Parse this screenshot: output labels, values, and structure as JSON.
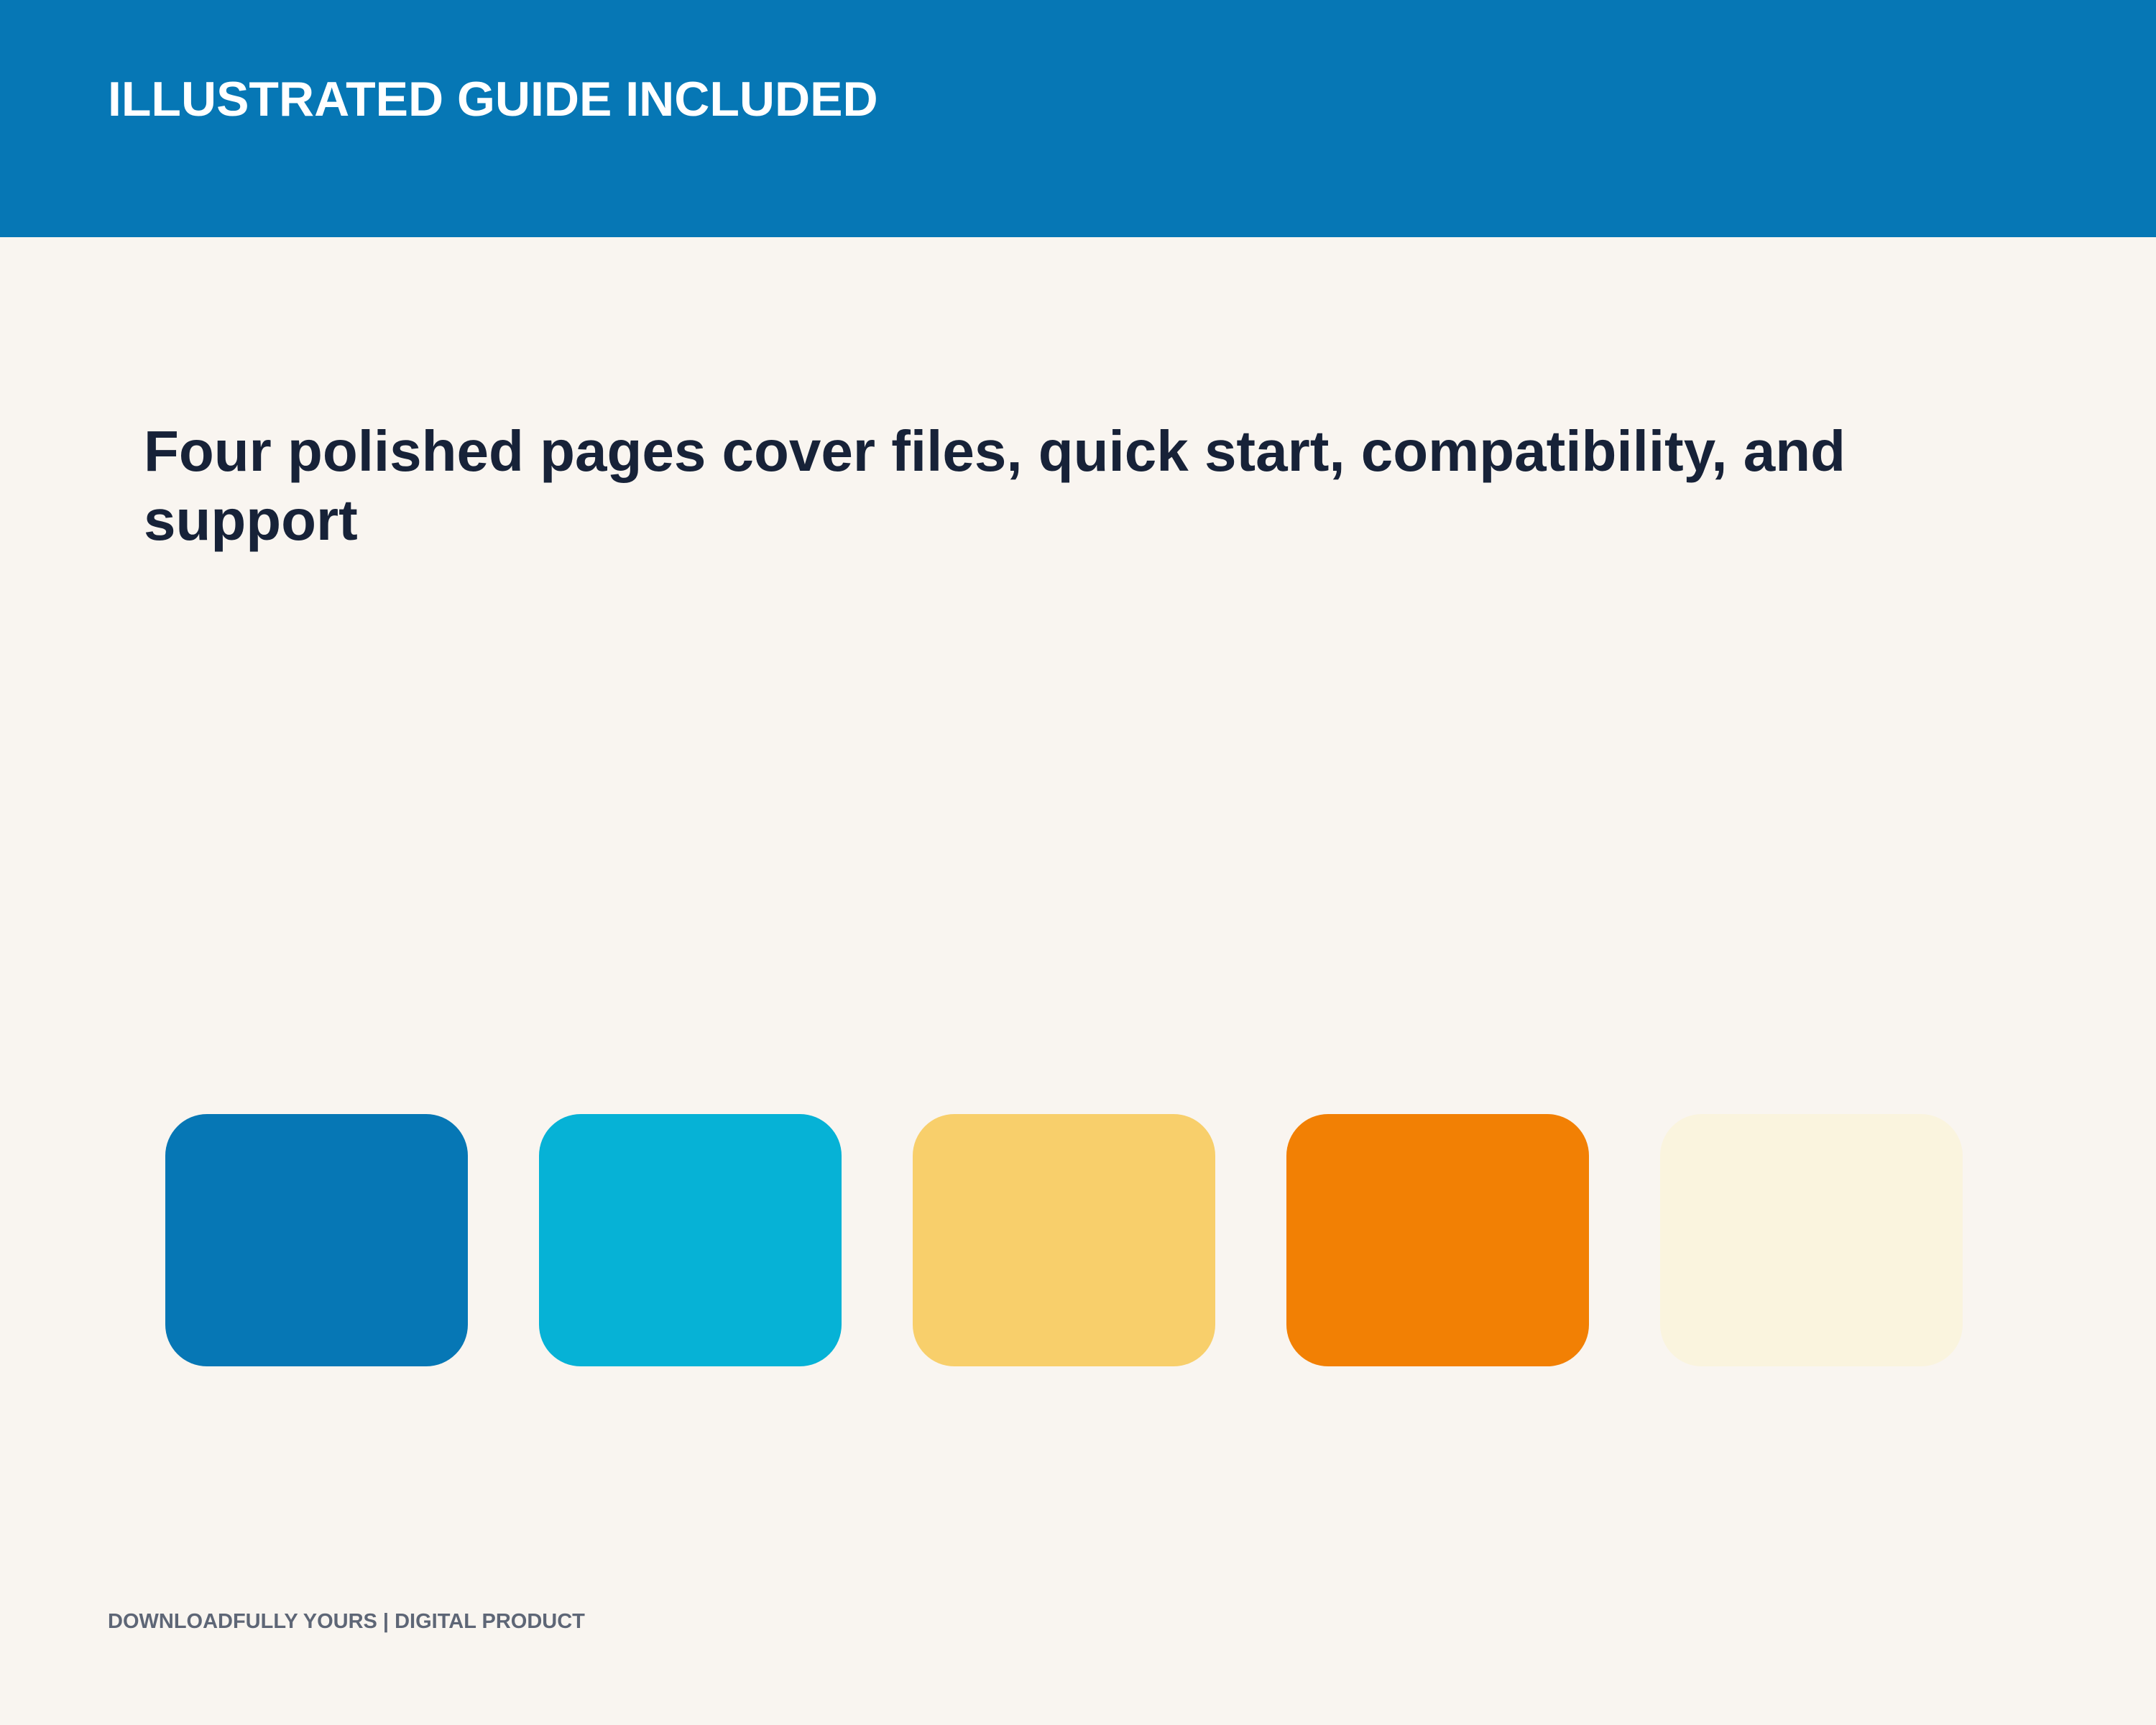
{
  "header": {
    "title": "ILLUSTRATED GUIDE INCLUDED",
    "band_color": "#0677b5"
  },
  "headline": {
    "text": "Four polished pages cover files, quick start, compatibility, and support"
  },
  "palette": [
    {
      "color": "#0677b5"
    },
    {
      "color": "#06b2d6"
    },
    {
      "color": "#f8cf6b"
    },
    {
      "color": "#f28004"
    },
    {
      "color": "#faf4de"
    }
  ],
  "footer": {
    "text": "DOWNLOADFULLY YOURS | DIGITAL PRODUCT"
  },
  "colors": {
    "background": "#f9f5f0",
    "headline_text": "#172238",
    "footer_text": "#5e6676"
  }
}
